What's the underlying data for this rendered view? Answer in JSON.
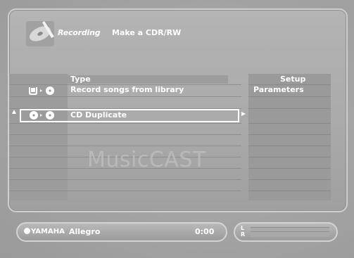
{
  "header": {
    "title": "Recording",
    "subtitle": "Make a CDR/RW",
    "icon": "cd-recording-icon"
  },
  "list": {
    "type_header": "Type",
    "setup_header": "Setup",
    "items": [
      {
        "label": "Record songs from library",
        "setup_value": "Parameters",
        "icon": "library-to-disc-icon"
      },
      {
        "label": "CD Duplicate",
        "setup_value": "",
        "icon": "disc-to-disc-icon",
        "selected": true
      }
    ]
  },
  "watermark": "MusicCAST",
  "status_bar": {
    "brand": "YAMAHA",
    "station": "Allegro",
    "time": "0:00",
    "level_label_left": "L",
    "level_label_right": "R"
  }
}
